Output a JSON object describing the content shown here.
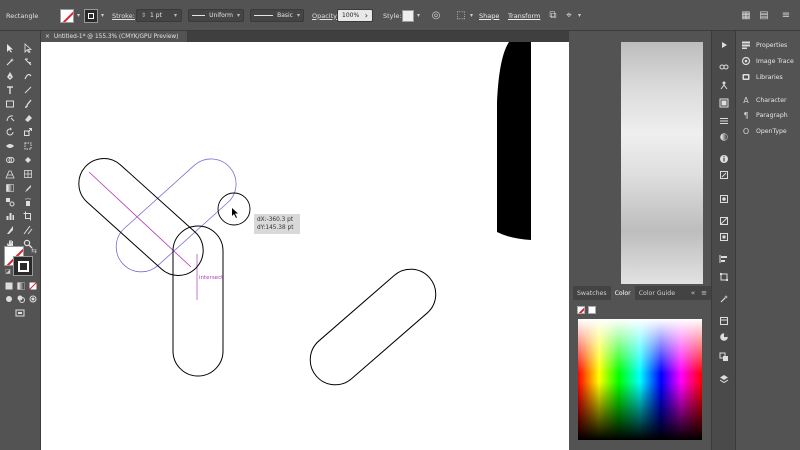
{
  "control_bar": {
    "selection_label": "Rectangle",
    "stroke_label": "Stroke:",
    "stroke_weight": "1 pt",
    "profile_uniform": "Uniform",
    "brush_basic": "Basic",
    "opacity_label": "Opacity:",
    "opacity_value": "100%",
    "style_label": "Style:",
    "shape_button": "Shape",
    "transform_button": "Transform"
  },
  "document_tab": {
    "title": "Untitled-1* @ 155.3% (CMYK/GPU Preview)",
    "close": "×"
  },
  "canvas": {
    "measure_dx": "dX:-360.3 pt",
    "measure_dy": "dY:145.38 pt",
    "smart_guide": "intersect"
  },
  "color_panel": {
    "tabs": [
      "Swatches",
      "Color",
      "Color Guide"
    ],
    "active_tab": "Color",
    "menu": "≡",
    "collapse": "«"
  },
  "right_panel": {
    "items": [
      {
        "label": "Properties",
        "icon": "properties-icon"
      },
      {
        "label": "Image Trace",
        "icon": "image-trace-icon"
      },
      {
        "label": "Libraries",
        "icon": "libraries-icon"
      },
      {
        "label": "Character",
        "icon": "character-icon",
        "glyph": "A"
      },
      {
        "label": "Paragraph",
        "icon": "paragraph-icon",
        "glyph": "¶"
      },
      {
        "label": "OpenType",
        "icon": "opentype-icon",
        "glyph": "O"
      }
    ]
  },
  "colors": {
    "chrome": "#535353",
    "canvas": "#ffffff",
    "smart_guide": "#b03ab0",
    "selection_outline": "#7a6fd0"
  }
}
